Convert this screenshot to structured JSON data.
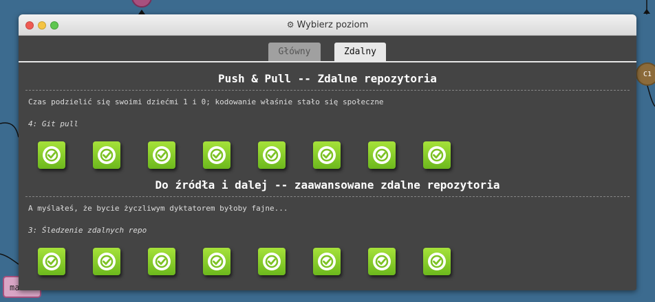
{
  "window": {
    "title": "Wybierz poziom",
    "title_icon": "gear-icon"
  },
  "tabs": [
    {
      "label": "Główny",
      "active": false
    },
    {
      "label": "Zdalny",
      "active": true
    }
  ],
  "sections": [
    {
      "title": "Push & Pull -- Zdalne repozytoria",
      "description": "Czas podzielić się swoimi dziećmi 1 i 0; kodowanie właśnie stało się społeczne",
      "current_level": "4: Git pull",
      "levels_completed": 8
    },
    {
      "title": "Do źródła i dalej -- zaawansowane zdalne repozytoria",
      "description": "A myślałeś, że bycie życzliwym dyktatorem byłoby fajne...",
      "current_level": "3: Śledzenie zdalnych repo",
      "levels_completed": 8
    }
  ],
  "background": {
    "node_label": "C1",
    "branch_label": "ma"
  },
  "colors": {
    "background": "#3c6b8f",
    "window_body": "#444444",
    "level_done": "#8fd02c"
  }
}
